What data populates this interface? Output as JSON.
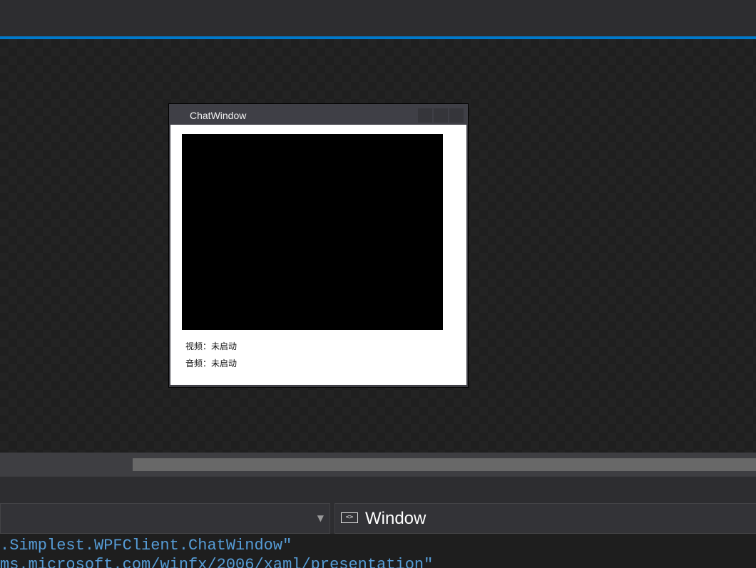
{
  "designer": {
    "window": {
      "title": "ChatWindow",
      "video_status": "视频：未启动",
      "audio_status": "音频：未启动"
    }
  },
  "navbar": {
    "type_dropdown_value": "",
    "member_dropdown_icon": "window-icon",
    "member_dropdown_label": "Window"
  },
  "code": {
    "line1": ".Simplest.WPFClient.ChatWindow\"",
    "line2": "ms.microsoft.com/winfx/2006/xaml/presentation\""
  },
  "colors": {
    "accent": "#007acc",
    "code_string": "#569cd6"
  }
}
